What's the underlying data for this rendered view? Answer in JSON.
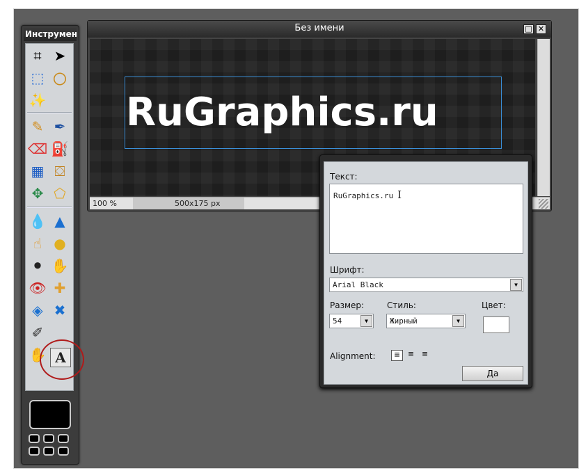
{
  "toolbox": {
    "title": "Инструмент",
    "tools": [
      {
        "name": "crop-icon",
        "glyph": "⌗"
      },
      {
        "name": "move-icon",
        "glyph": "➤"
      },
      {
        "name": "marquee-icon",
        "glyph": "⬚"
      },
      {
        "name": "lasso-icon",
        "glyph": "〇"
      },
      {
        "name": "magic-wand-icon",
        "glyph": "✨"
      },
      {
        "name": "pencil-icon",
        "glyph": "✎"
      },
      {
        "name": "brush-icon",
        "glyph": "✒"
      },
      {
        "name": "eraser-icon",
        "glyph": "⌫"
      },
      {
        "name": "paint-bucket-icon",
        "glyph": "⛽"
      },
      {
        "name": "gradient-icon",
        "glyph": "▦"
      },
      {
        "name": "stamp-icon",
        "glyph": "⛋"
      },
      {
        "name": "color-replace-icon",
        "glyph": "✥"
      },
      {
        "name": "shape-icon",
        "glyph": "⬠"
      },
      {
        "name": "blur-icon",
        "glyph": "💧"
      },
      {
        "name": "sharpen-icon",
        "glyph": "▲"
      },
      {
        "name": "smudge-icon",
        "glyph": "☝"
      },
      {
        "name": "sponge-icon",
        "glyph": "●"
      },
      {
        "name": "burn-icon",
        "glyph": "⚫"
      },
      {
        "name": "dodge-icon",
        "glyph": "✋"
      },
      {
        "name": "red-eye-icon",
        "glyph": "👁"
      },
      {
        "name": "spot-heal-icon",
        "glyph": "✚"
      },
      {
        "name": "bloat-icon",
        "glyph": "◈"
      },
      {
        "name": "pinch-icon",
        "glyph": "✖"
      },
      {
        "name": "color-picker-icon",
        "glyph": "✐"
      },
      {
        "name": "text-tool-icon",
        "glyph": "A"
      },
      {
        "name": "hand-icon",
        "glyph": "✋"
      },
      {
        "name": "zoom-icon",
        "glyph": "🔍"
      }
    ]
  },
  "image_window": {
    "title": "Без имени",
    "canvas_text": "RuGraphics.ru",
    "zoom": "100 %",
    "size": "500x175 px",
    "restore_glyph": "□",
    "close_glyph": "✕"
  },
  "text_dialog": {
    "text_label": "Текст:",
    "text_value": "RuGraphics.ru",
    "font_label": "Шрифт:",
    "font_value": "Arial Black",
    "size_label": "Размер:",
    "size_value": "54",
    "style_label": "Стиль:",
    "style_value": "Жирный",
    "color_label": "Цвет:",
    "color_value": "#ffffff",
    "alignment_label": "Alignment:",
    "align_glyphs": [
      "≡",
      "≡",
      "≡"
    ],
    "ok_label": "Да",
    "dropdown_glyph": "▼"
  }
}
